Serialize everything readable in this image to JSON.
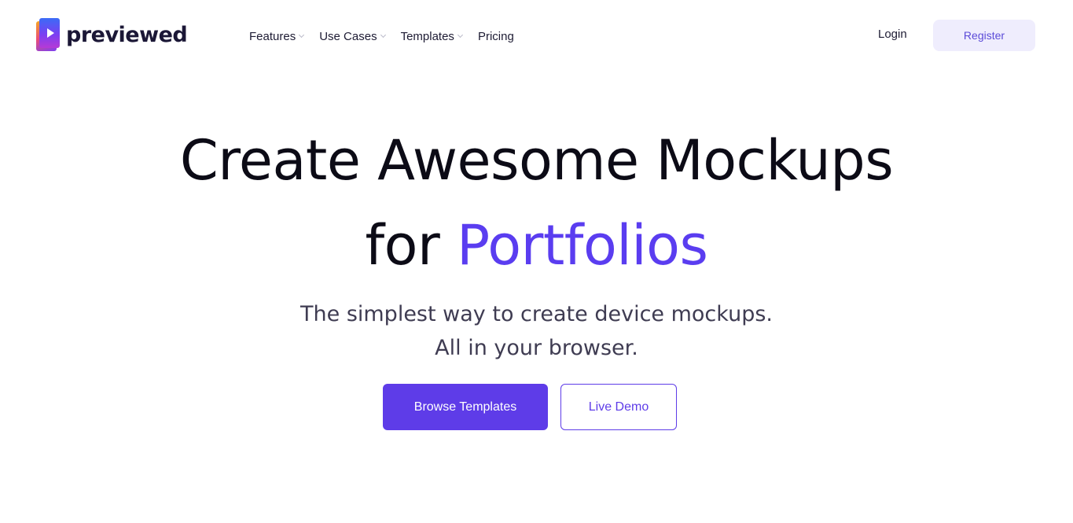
{
  "brand": {
    "name": "previewed",
    "icon": "logo-play-icon",
    "colors": {
      "accent": "#5e3ce8",
      "text": "#1b1736"
    }
  },
  "nav": {
    "items": [
      {
        "label": "Features",
        "has_dropdown": true
      },
      {
        "label": "Use Cases",
        "has_dropdown": true
      },
      {
        "label": "Templates",
        "has_dropdown": true
      },
      {
        "label": "Pricing",
        "has_dropdown": false
      }
    ],
    "login_label": "Login",
    "register_label": "Register"
  },
  "hero": {
    "title_line1": "Create Awesome Mockups",
    "title_line2_prefix": "for ",
    "title_line2_accent": "Portfolios",
    "subtitle_line1": "The simplest way to create device mockups.",
    "subtitle_line2": "All in your browser.",
    "primary_cta": "Browse Templates",
    "secondary_cta": "Live Demo"
  }
}
